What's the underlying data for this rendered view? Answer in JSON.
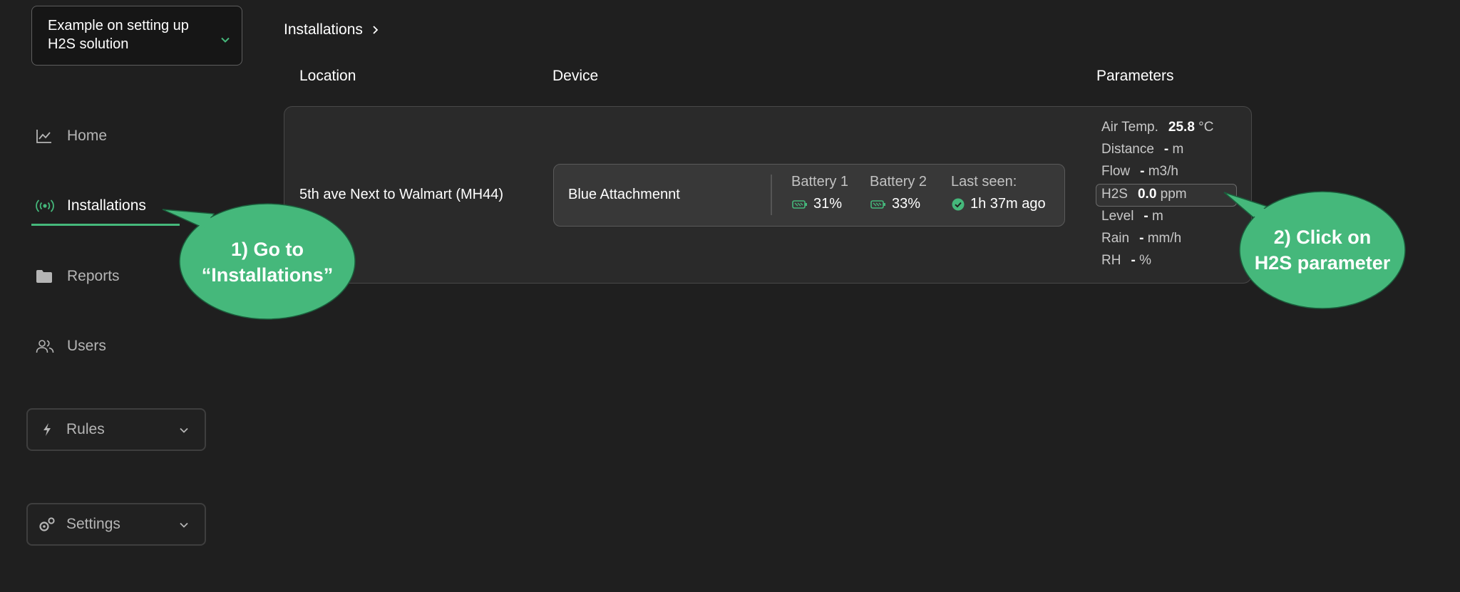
{
  "project_selector": {
    "label": "Example on setting up H2S solution"
  },
  "sidebar": {
    "items": [
      {
        "label": "Home",
        "icon": "chart-line-icon"
      },
      {
        "label": "Installations",
        "icon": "broadcast-icon"
      },
      {
        "label": "Reports",
        "icon": "folder-icon"
      },
      {
        "label": "Users",
        "icon": "users-icon"
      }
    ],
    "rules_label": "Rules",
    "settings_label": "Settings"
  },
  "breadcrumb": {
    "label": "Installations"
  },
  "table": {
    "headers": {
      "location": "Location",
      "device": "Device",
      "parameters": "Parameters"
    },
    "row": {
      "location": "5th ave Next to Walmart (MH44)",
      "device_name": "Blue Attachmennt",
      "battery1_label": "Battery 1",
      "battery1_value": "31%",
      "battery2_label": "Battery 2",
      "battery2_value": "33%",
      "last_seen_label": "Last seen:",
      "last_seen_value": "1h 37m ago",
      "parameters": [
        {
          "name": "Air Temp.",
          "value": "25.8",
          "unit": "°C"
        },
        {
          "name": "Distance",
          "value": "-",
          "unit": "m"
        },
        {
          "name": "Flow",
          "value": "-",
          "unit": "m3/h"
        },
        {
          "name": "H2S",
          "value": "0.0",
          "unit": "ppm"
        },
        {
          "name": "Level",
          "value": "-",
          "unit": "m"
        },
        {
          "name": "Rain",
          "value": "-",
          "unit": "mm/h"
        },
        {
          "name": "RH",
          "value": "-",
          "unit": "%"
        }
      ]
    }
  },
  "callouts": {
    "step1_line1": "1) Go to",
    "step1_line2": "“Installations”",
    "step2_line1": "2) Click on",
    "step2_line2": "H2S parameter"
  },
  "colors": {
    "accent": "#45b87b",
    "background": "#1f1f1f",
    "card": "#2a2a2a"
  }
}
